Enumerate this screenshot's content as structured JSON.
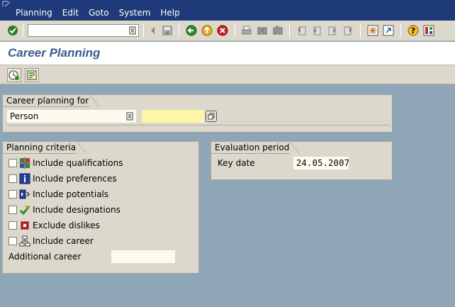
{
  "menu": {
    "items": [
      "Planning",
      "Edit",
      "Goto",
      "System",
      "Help"
    ]
  },
  "toolbar": {
    "command_field_value": "",
    "icons": [
      "enter-icon",
      "back-icon",
      "save-icon",
      "green-back-icon",
      "exit-icon",
      "cancel-icon",
      "print-icon",
      "find-icon",
      "find-next-icon",
      "first-page-icon",
      "previous-page-icon",
      "next-page-icon",
      "last-page-icon",
      "create-session-icon",
      "shortcut-icon",
      "help-icon",
      "layout-icon"
    ]
  },
  "page": {
    "title": "Career Planning"
  },
  "app_toolbar": {
    "icons": [
      "execute-icon",
      "variant-icon"
    ]
  },
  "career_for": {
    "group_title": "Career planning for",
    "object_type": "Person",
    "object_id": ""
  },
  "criteria": {
    "group_title": "Planning criteria",
    "items": [
      {
        "label": "Include qualifications",
        "icon": "qualifications-icon",
        "checked": false
      },
      {
        "label": "Include preferences",
        "icon": "info-icon",
        "checked": false
      },
      {
        "label": "Include potentials",
        "icon": "potentials-icon",
        "checked": false
      },
      {
        "label": "Include designations",
        "icon": "designations-icon",
        "checked": false
      },
      {
        "label": "Exclude dislikes",
        "icon": "dislikes-icon",
        "checked": false
      },
      {
        "label": "Include career",
        "icon": "career-icon",
        "checked": false
      }
    ],
    "additional_label": "Additional career",
    "additional_value": ""
  },
  "evaluation": {
    "group_title": "Evaluation period",
    "key_date_label": "Key date",
    "key_date_value": "24.05.2007"
  }
}
